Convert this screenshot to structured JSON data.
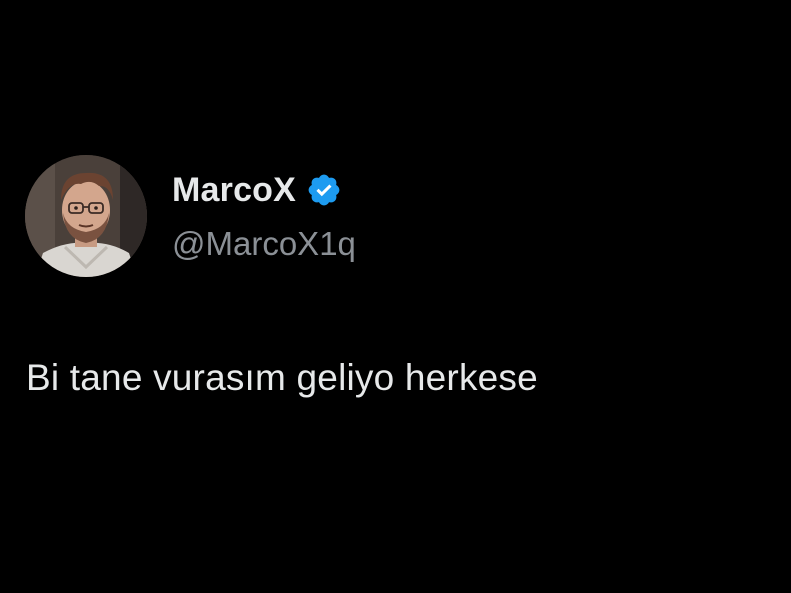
{
  "author": {
    "display_name": "MarcoX",
    "handle": "@MarcoX1q",
    "verified": true,
    "verified_badge_color": "#1d9bf0",
    "avatar_icon": "profile-photo"
  },
  "tweet": {
    "text": "Bi tane vurasım geliyo herkese"
  },
  "colors": {
    "background": "#000000",
    "primary_text": "#e7e9ea",
    "secondary_text": "#8b9096"
  }
}
